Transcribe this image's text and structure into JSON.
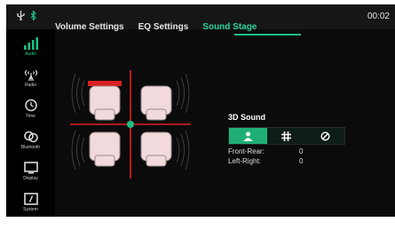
{
  "status": {
    "time": "00:02"
  },
  "sidebar": {
    "items": [
      {
        "label": "Audio",
        "icon": "audio-bars-icon",
        "active": true
      },
      {
        "label": "Radio",
        "icon": "radio-antenna-icon",
        "active": false
      },
      {
        "label": "Time",
        "icon": "clock-icon",
        "active": false
      },
      {
        "label": "Bluetooth",
        "icon": "bluetooth-link-icon",
        "active": false
      },
      {
        "label": "Display",
        "icon": "display-icon",
        "active": false
      },
      {
        "label": "System",
        "icon": "system-icon",
        "active": false
      }
    ]
  },
  "tabs": [
    {
      "label": "Volume Settings",
      "active": false
    },
    {
      "label": "EQ Settings",
      "active": false
    },
    {
      "label": "Sound Stage",
      "active": true
    }
  ],
  "sound3d": {
    "title": "3D Sound",
    "modes": [
      {
        "icon": "person-icon",
        "active": true
      },
      {
        "icon": "grid-icon",
        "active": false
      },
      {
        "icon": "off-circle-icon",
        "active": false
      }
    ],
    "front_rear_label": "Front-Rear:",
    "front_rear_value": "0",
    "left_right_label": "Left-Right:",
    "left_right_value": "0"
  },
  "colors": {
    "accent": "#1fbf84",
    "crosshair": "#e02020"
  }
}
